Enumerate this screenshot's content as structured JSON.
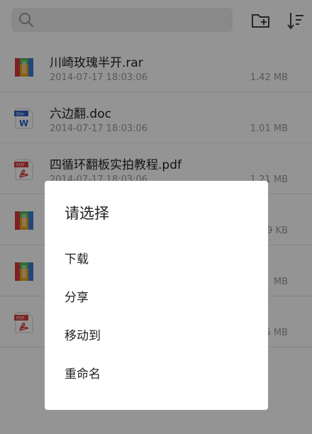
{
  "colors": {
    "rar": "#e8a220",
    "doc": "#2f5fbf",
    "pdf": "#d63b3b",
    "text": "#222222",
    "meta": "#9a9a9a"
  },
  "toolbar": {
    "search_icon": "search-icon",
    "new_folder_icon": "folder-add-icon",
    "sort_icon": "sort-icon"
  },
  "files": [
    {
      "type": "rar",
      "icon": "rar-archive-icon",
      "name": "川崎玫瑰半开.rar",
      "date": "2014-07-17 18:03:06",
      "size": "1.42 MB"
    },
    {
      "type": "doc",
      "icon": "word-document-icon",
      "badge": "Doc",
      "letter": "W",
      "name": "六边翻.doc",
      "date": "2014-07-17 18:03:06",
      "size": "1.01 MB"
    },
    {
      "type": "pdf",
      "icon": "pdf-document-icon",
      "badge": "PDF",
      "name": "四循环翻板实拍教程.pdf",
      "date": "2014-07-17 18:03:06",
      "size": "1.21 MB"
    },
    {
      "type": "rar",
      "icon": "rar-archive-icon",
      "name": "",
      "date": "",
      "size": "9 KB"
    },
    {
      "type": "rar",
      "icon": "rar-archive-icon",
      "name": "",
      "date": "",
      "size": "MB"
    },
    {
      "type": "pdf",
      "icon": "pdf-document-icon",
      "badge": "PDF",
      "name": "",
      "date": "",
      "size": "5 MB"
    }
  ],
  "dialog": {
    "title": "请选择",
    "options": [
      "下载",
      "分享",
      "移动到",
      "重命名"
    ]
  }
}
